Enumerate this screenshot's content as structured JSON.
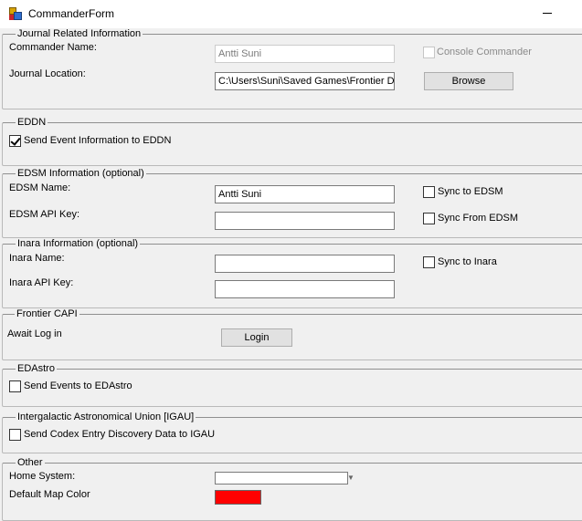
{
  "window": {
    "title": "CommanderForm"
  },
  "journal": {
    "legend": "Journal Related Information",
    "commander_name_label": "Commander Name:",
    "commander_name_value": "Antti Suni",
    "console_commander_label": "Console Commander",
    "journal_location_label": "Journal Location:",
    "journal_location_value": "C:\\Users\\Suni\\Saved Games\\Frontier D",
    "browse_label": "Browse"
  },
  "eddn": {
    "legend": "EDDN",
    "send_label": "Send Event Information to EDDN",
    "send_checked": true
  },
  "edsm": {
    "legend": "EDSM Information (optional)",
    "name_label": "EDSM Name:",
    "name_value": "Antti Suni",
    "api_key_label": "EDSM API Key:",
    "api_key_value": "",
    "sync_to_label": "Sync to EDSM",
    "sync_from_label": "Sync From EDSM"
  },
  "inara": {
    "legend": "Inara Information (optional)",
    "name_label": "Inara Name:",
    "name_value": "",
    "api_key_label": "Inara API Key:",
    "api_key_value": "",
    "sync_to_label": "Sync to Inara"
  },
  "capi": {
    "legend": "Frontier CAPI",
    "status_label": "Await Log in",
    "login_label": "Login"
  },
  "edastro": {
    "legend": "EDAstro",
    "send_label": "Send Events to EDAstro"
  },
  "igau": {
    "legend": "Intergalactic Astronomical Union [IGAU]",
    "send_label": "Send Codex Entry Discovery Data to IGAU"
  },
  "other": {
    "legend": "Other",
    "home_system_label": "Home System:",
    "home_system_value": "",
    "map_color_label": "Default Map Color",
    "map_color": "#ff0000"
  }
}
